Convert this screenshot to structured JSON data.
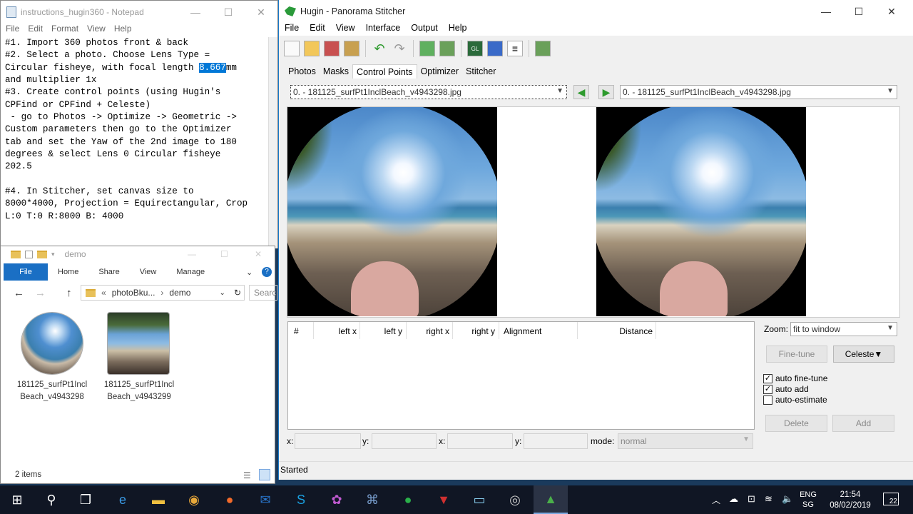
{
  "notepad": {
    "title": "instructions_hugin360 - Notepad",
    "menu": [
      "File",
      "Edit",
      "Format",
      "View",
      "Help"
    ],
    "lines_before_sel": "#1. Import 360 photos front & back\n#2. Select a photo. Choose Lens Type =\nCircular fisheye, with focal length ",
    "selected": "8.667",
    "lines_after_sel": "mm\nand multiplier 1x\n#3. Create control points (using Hugin's\nCPFind or CPFind + Celeste)\n - go to Photos -> Optimize -> Geometric ->\nCustom parameters then go to the Optimizer\ntab and set the Yaw of the 2nd image to 180\ndegrees & select Lens 0 Circular fisheye\n202.5\n\n#4. In Stitcher, set canvas size to\n8000*4000, Projection = Equirectangular, Crop\nL:0 T:0 R:8000 B: 4000"
  },
  "explorer": {
    "title": "demo",
    "ribbon": [
      "File",
      "Home",
      "Share",
      "View",
      "Manage"
    ],
    "path": [
      "photoBku...",
      "demo"
    ],
    "search": "Searc",
    "files": [
      {
        "name": "181125_surfPt1InclBeach_v4943298"
      },
      {
        "name": "181125_surfPt1InclBeach_v4943299"
      }
    ],
    "status": "2 items"
  },
  "hugin": {
    "title": "Hugin - Panorama Stitcher",
    "menu": [
      "File",
      "Edit",
      "View",
      "Interface",
      "Output",
      "Help"
    ],
    "tabs": [
      "Photos",
      "Masks",
      "Control Points",
      "Optimizer",
      "Stitcher"
    ],
    "active_tab": "Control Points",
    "left_image": "0. - 181125_surfPt1InclBeach_v4943298.jpg",
    "right_image": "0. - 181125_surfPt1InclBeach_v4943298.jpg",
    "table_headers": [
      "#",
      "left x",
      "left y",
      "right x",
      "right y",
      "Alignment",
      "Distance"
    ],
    "zoom_label": "Zoom:",
    "zoom_value": "fit to window",
    "fine_tune": "Fine-tune",
    "celeste": "Celeste▼",
    "auto_fine_tune": "auto fine-tune",
    "auto_add": "auto add",
    "auto_estimate": "auto-estimate",
    "delete": "Delete",
    "add": "Add",
    "x_label": "x:",
    "y_label": "y:",
    "mode_label": "mode:",
    "mode_value": "normal",
    "status": "Started"
  },
  "taskbar": {
    "lang1": "ENG",
    "lang2": "SG",
    "time": "21:54",
    "date": "08/02/2019",
    "notifications": "22"
  }
}
